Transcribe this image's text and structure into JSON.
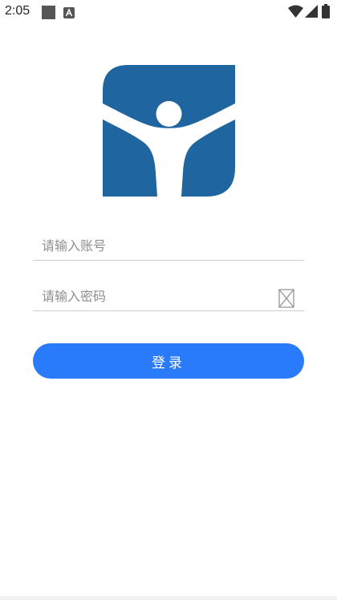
{
  "status_bar": {
    "time": "2:05"
  },
  "colors": {
    "brand": "#1f66a0",
    "accent": "#2a7bfb"
  },
  "login_form": {
    "account_placeholder": "请输入账号",
    "password_placeholder": "请输入密码",
    "password_toggle_icon": "password-visibility-icon",
    "login_label": "登录"
  }
}
